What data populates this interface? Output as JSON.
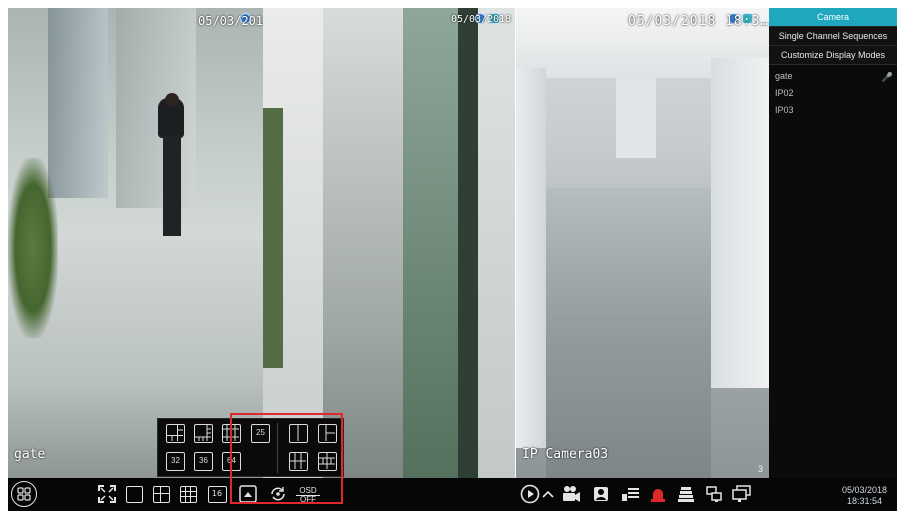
{
  "tiles": [
    {
      "id": "tile1",
      "datetime": "05/03/2018 18:3…",
      "name": "gate"
    },
    {
      "id": "tile2",
      "datetime": "05/03/2018 18:31:5…",
      "name": ""
    },
    {
      "id": "tile3",
      "datetime": "05/03/2018 18:3…7",
      "name": "IP Camera03",
      "num": "3"
    }
  ],
  "panel": {
    "tab_camera": "Camera",
    "tab_sequences": "Single Channel Sequences",
    "tab_custom": "Customize Display Modes",
    "cameras": [
      "gate",
      "IP02",
      "IP03"
    ]
  },
  "toolbar": {
    "osd_label": "OSD",
    "osd_state": "OFF",
    "layout16": "16"
  },
  "popup": {
    "layout25": "25",
    "layout32": "32",
    "layout36": "36",
    "layout64": "64"
  },
  "clock": {
    "date": "05/03/2018",
    "time": "18:31:54"
  },
  "icons": {
    "start": "menu-grid-icon",
    "fullscreen": "fullscreen-icon",
    "play": "play-circle-icon",
    "alarm_color": "#e0282c",
    "highlight_color": "#e0282c",
    "accent": "#1fa7bd"
  }
}
